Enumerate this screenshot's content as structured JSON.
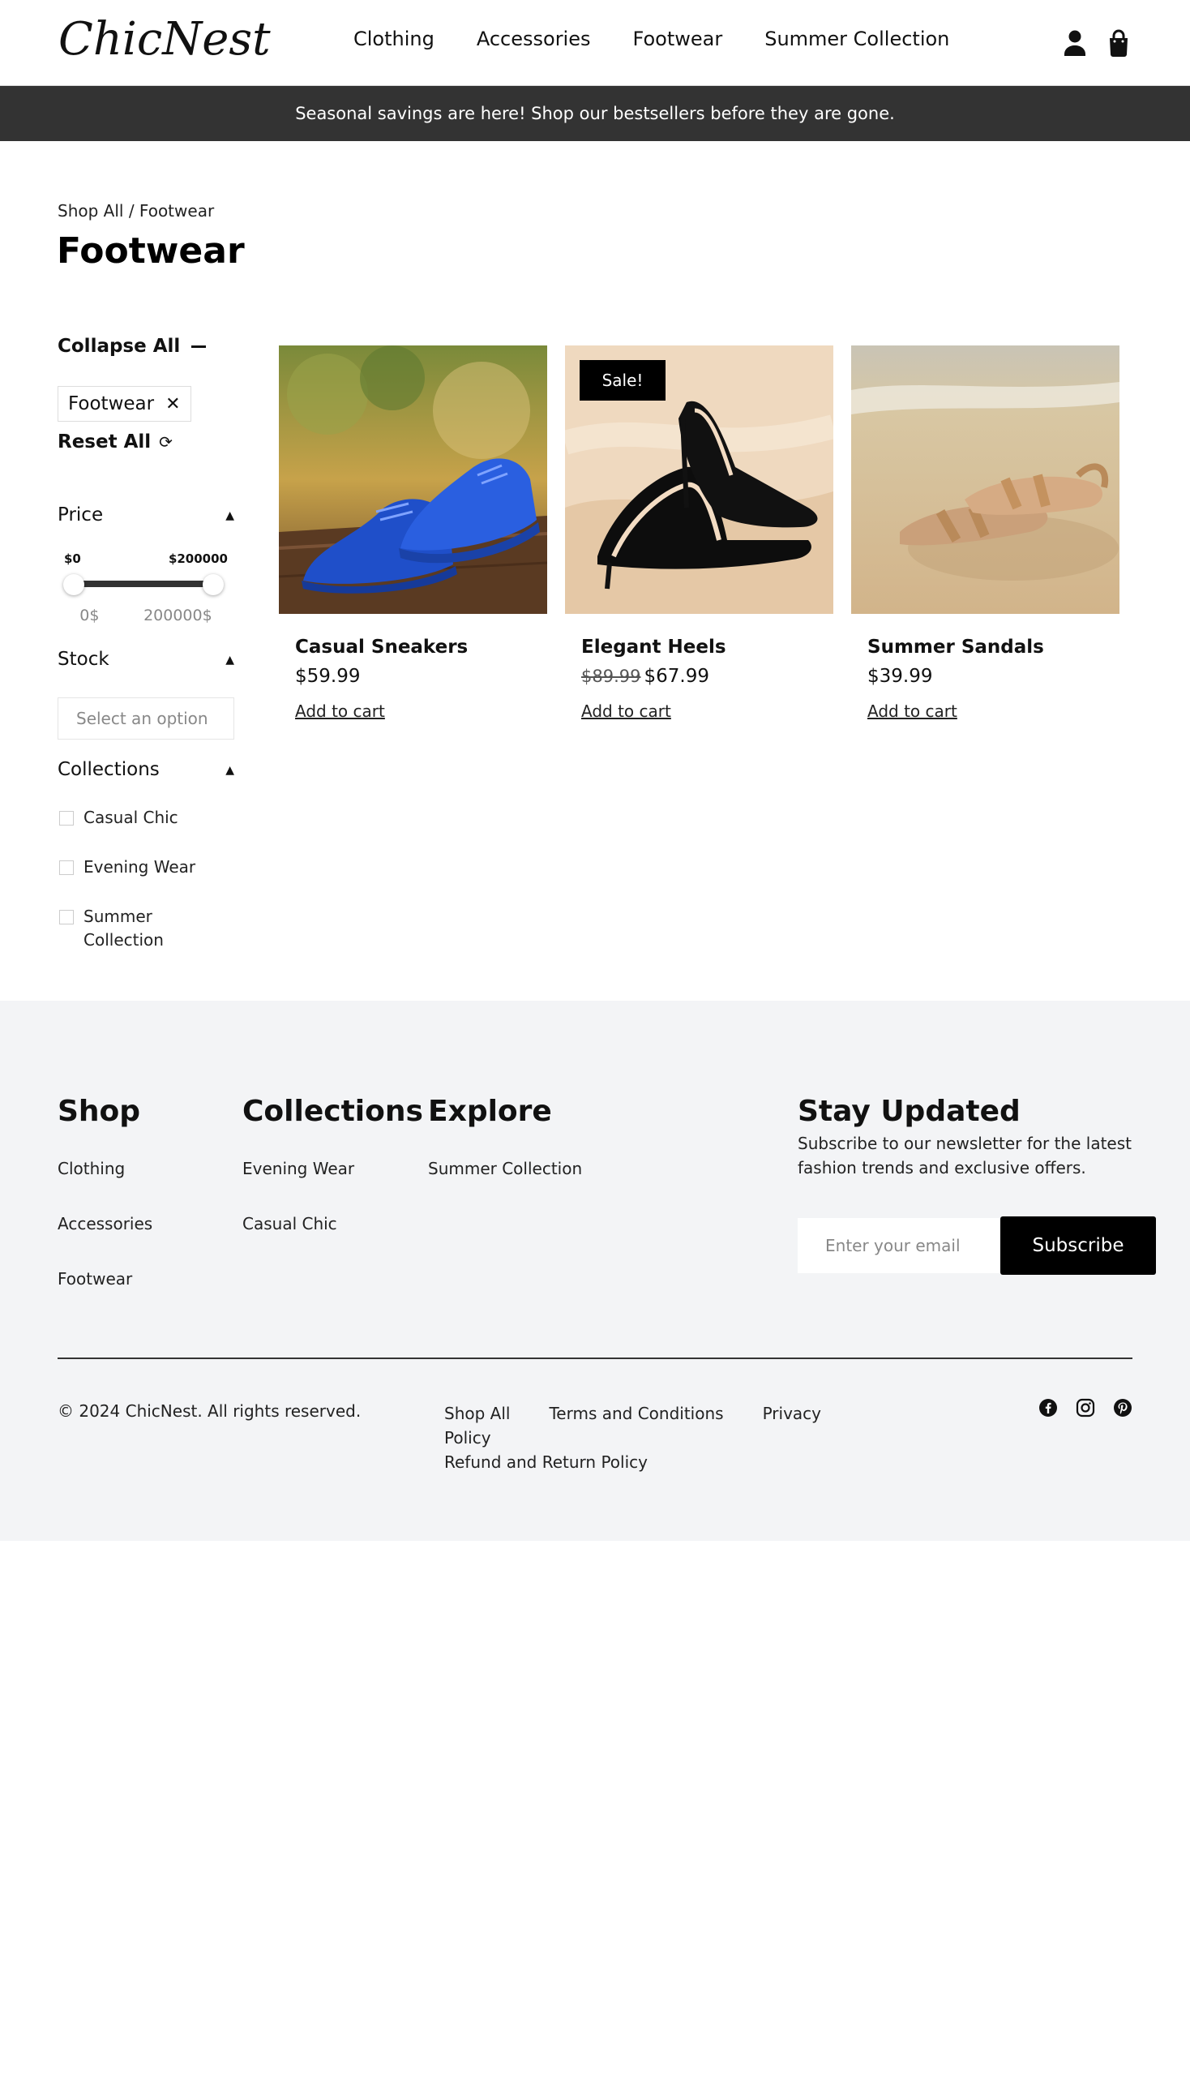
{
  "header": {
    "logo": "ChicNest",
    "nav": [
      "Clothing",
      "Accessories",
      "Footwear",
      "Summer Collection"
    ],
    "icons": [
      "user-icon",
      "shopping-bag-icon"
    ]
  },
  "announcement": "Seasonal savings are here! Shop our bestsellers before they are gone.",
  "breadcrumb": {
    "parent": "Shop All",
    "separator": " / ",
    "current": "Footwear"
  },
  "page_title": "Footwear",
  "filters": {
    "collapse_all": "Collapse All",
    "active_chip": "Footwear",
    "reset_all": "Reset All",
    "price": {
      "label": "Price",
      "min_label": "$0",
      "max_label": "$200000",
      "min_value": "0$",
      "max_value": "200000$",
      "selected_min": 0,
      "selected_max": 200000
    },
    "stock": {
      "label": "Stock",
      "placeholder": "Select an option"
    },
    "collections": {
      "label": "Collections",
      "items": [
        "Casual Chic",
        "Evening Wear",
        "Summer Collection"
      ]
    }
  },
  "products": [
    {
      "name": "Casual Sneakers",
      "price": "$59.99",
      "old_price": "",
      "badge": "",
      "cta": "Add to cart"
    },
    {
      "name": "Elegant Heels",
      "price": "$67.99",
      "old_price": "$89.99",
      "badge": "Sale!",
      "cta": "Add to cart"
    },
    {
      "name": "Summer Sandals",
      "price": "$39.99",
      "old_price": "",
      "badge": "",
      "cta": "Add to cart"
    }
  ],
  "footer": {
    "shop": {
      "title": "Shop",
      "links": [
        "Clothing",
        "Accessories",
        "Footwear"
      ]
    },
    "collections": {
      "title": "Collections",
      "links": [
        "Evening Wear",
        "Casual Chic"
      ]
    },
    "explore": {
      "title": "Explore",
      "links": [
        "Summer Collection"
      ]
    },
    "newsletter": {
      "title": "Stay Updated",
      "text": "Subscribe to our newsletter for the latest fashion trends and exclusive offers.",
      "placeholder": "Enter your email",
      "button": "Subscribe"
    },
    "copyright": "© 2024 ChicNest. All rights reserved.",
    "legal": [
      "Shop All",
      "Terms and Conditions",
      "Privacy Policy",
      "Refund and Return Policy"
    ],
    "social": [
      "facebook-icon",
      "instagram-icon",
      "pinterest-icon"
    ]
  }
}
